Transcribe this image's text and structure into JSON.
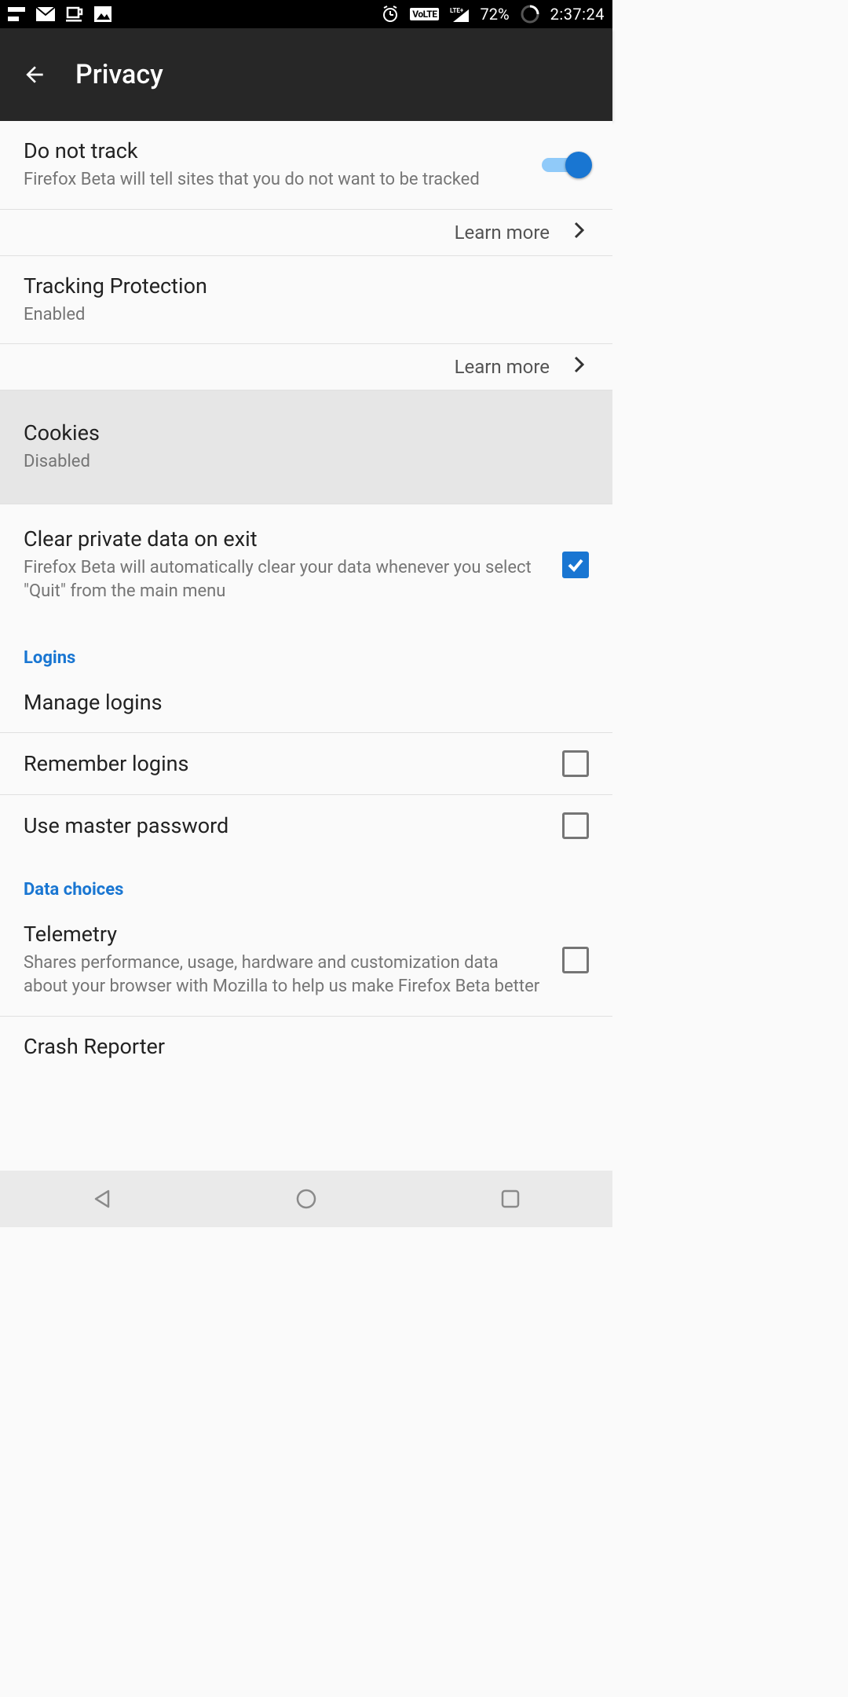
{
  "status": {
    "battery": "72%",
    "clock": "2:37:24",
    "lte_badge": "VoLTE"
  },
  "header": {
    "title": "Privacy"
  },
  "rows": {
    "dnt": {
      "title": "Do not track",
      "sub": "Firefox Beta will tell sites that you do not want to be tracked",
      "learn": "Learn more"
    },
    "tracking": {
      "title": "Tracking Protection",
      "sub": "Enabled",
      "learn": "Learn more"
    },
    "cookies": {
      "title": "Cookies",
      "sub": "Disabled"
    },
    "clear_exit": {
      "title": "Clear private data on exit",
      "sub": "Firefox Beta will automatically clear your data whenever you select \"Quit\" from the main menu"
    },
    "manage_logins": {
      "title": "Manage logins"
    },
    "remember_logins": {
      "title": "Remember logins"
    },
    "master_pw": {
      "title": "Use master password"
    },
    "telemetry": {
      "title": "Telemetry",
      "sub": "Shares performance, usage, hardware and customization data about your browser with Mozilla to help us make Firefox Beta better"
    },
    "crash": {
      "title": "Crash Reporter"
    }
  },
  "sections": {
    "logins": "Logins",
    "data_choices": "Data choices"
  }
}
